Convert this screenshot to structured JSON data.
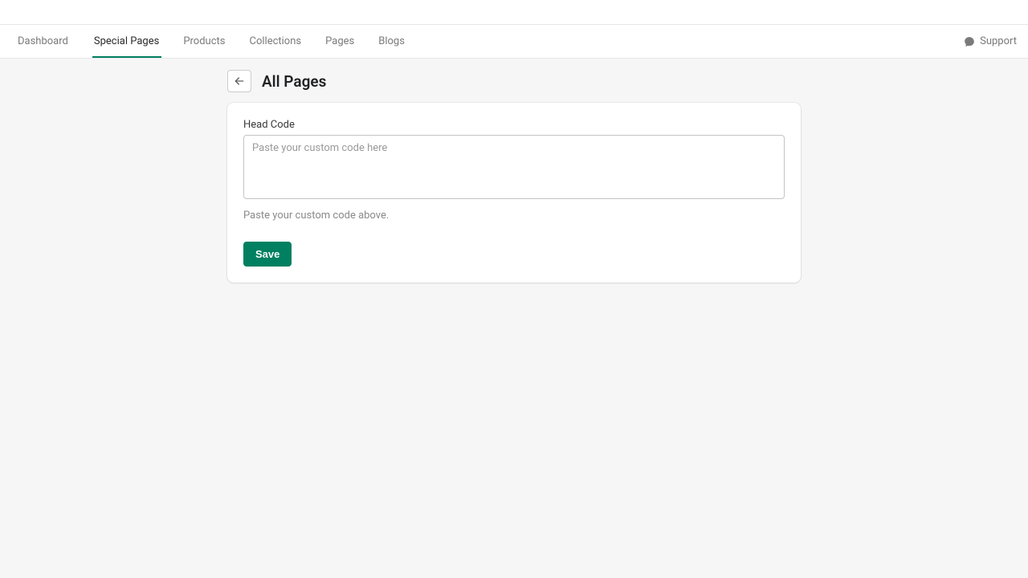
{
  "nav": {
    "tabs": [
      {
        "label": "Dashboard",
        "active": false
      },
      {
        "label": "Special Pages",
        "active": true
      },
      {
        "label": "Products",
        "active": false
      },
      {
        "label": "Collections",
        "active": false
      },
      {
        "label": "Pages",
        "active": false
      },
      {
        "label": "Blogs",
        "active": false
      }
    ],
    "support_label": "Support"
  },
  "page": {
    "title": "All Pages"
  },
  "form": {
    "head_code_label": "Head Code",
    "head_code_placeholder": "Paste your custom code here",
    "head_code_value": "",
    "head_code_help": "Paste your custom code above.",
    "save_label": "Save"
  }
}
